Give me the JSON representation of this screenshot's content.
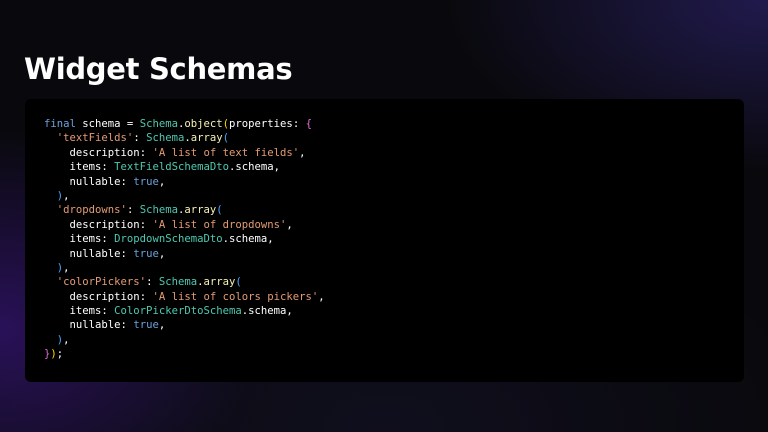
{
  "slide": {
    "title": "Widget Schemas"
  },
  "colors": {
    "background": "#09090d",
    "panel": "#000000",
    "keyword": "#6ba2dc",
    "class_name": "#4ec9b0",
    "method": "#f4f1b4",
    "string": "#e49b74",
    "bracket_level_1": "#ffd700",
    "bracket_level_2": "#da70d6",
    "bracket_level_3": "#4aa8ff"
  },
  "code": {
    "language": "dart",
    "lines": [
      [
        [
          "kw",
          "final"
        ],
        [
          "id",
          " schema "
        ],
        [
          "punc",
          "= "
        ],
        [
          "cls",
          "Schema"
        ],
        [
          "punc",
          "."
        ],
        [
          "fn",
          "object"
        ],
        [
          "p1",
          "("
        ],
        [
          "prop",
          "properties"
        ],
        [
          "punc",
          ": "
        ],
        [
          "p2",
          "{"
        ]
      ],
      [
        [
          "id",
          "  "
        ],
        [
          "str",
          "'textFields'"
        ],
        [
          "punc",
          ": "
        ],
        [
          "cls",
          "Schema"
        ],
        [
          "punc",
          "."
        ],
        [
          "fn",
          "array"
        ],
        [
          "p3",
          "("
        ]
      ],
      [
        [
          "id",
          "    "
        ],
        [
          "prop",
          "description"
        ],
        [
          "punc",
          ": "
        ],
        [
          "str",
          "'A list of text fields'"
        ],
        [
          "punc",
          ","
        ]
      ],
      [
        [
          "id",
          "    "
        ],
        [
          "prop",
          "items"
        ],
        [
          "punc",
          ": "
        ],
        [
          "cls",
          "TextFieldSchemaDto"
        ],
        [
          "punc",
          "."
        ],
        [
          "prop",
          "schema"
        ],
        [
          "punc",
          ","
        ]
      ],
      [
        [
          "id",
          "    "
        ],
        [
          "prop",
          "nullable"
        ],
        [
          "punc",
          ": "
        ],
        [
          "bool",
          "true"
        ],
        [
          "punc",
          ","
        ]
      ],
      [
        [
          "id",
          "  "
        ],
        [
          "p3",
          ")"
        ],
        [
          "punc",
          ","
        ]
      ],
      [
        [
          "id",
          "  "
        ],
        [
          "str",
          "'dropdowns'"
        ],
        [
          "punc",
          ": "
        ],
        [
          "cls",
          "Schema"
        ],
        [
          "punc",
          "."
        ],
        [
          "fn",
          "array"
        ],
        [
          "p3",
          "("
        ]
      ],
      [
        [
          "id",
          "    "
        ],
        [
          "prop",
          "description"
        ],
        [
          "punc",
          ": "
        ],
        [
          "str",
          "'A list of dropdowns'"
        ],
        [
          "punc",
          ","
        ]
      ],
      [
        [
          "id",
          "    "
        ],
        [
          "prop",
          "items"
        ],
        [
          "punc",
          ": "
        ],
        [
          "cls",
          "DropdownSchemaDto"
        ],
        [
          "punc",
          "."
        ],
        [
          "prop",
          "schema"
        ],
        [
          "punc",
          ","
        ]
      ],
      [
        [
          "id",
          "    "
        ],
        [
          "prop",
          "nullable"
        ],
        [
          "punc",
          ": "
        ],
        [
          "bool",
          "true"
        ],
        [
          "punc",
          ","
        ]
      ],
      [
        [
          "id",
          "  "
        ],
        [
          "p3",
          ")"
        ],
        [
          "punc",
          ","
        ]
      ],
      [
        [
          "id",
          "  "
        ],
        [
          "str",
          "'colorPickers'"
        ],
        [
          "punc",
          ": "
        ],
        [
          "cls",
          "Schema"
        ],
        [
          "punc",
          "."
        ],
        [
          "fn",
          "array"
        ],
        [
          "p3",
          "("
        ]
      ],
      [
        [
          "id",
          "    "
        ],
        [
          "prop",
          "description"
        ],
        [
          "punc",
          ": "
        ],
        [
          "str",
          "'A list of colors pickers'"
        ],
        [
          "punc",
          ","
        ]
      ],
      [
        [
          "id",
          "    "
        ],
        [
          "prop",
          "items"
        ],
        [
          "punc",
          ": "
        ],
        [
          "cls",
          "ColorPickerDtoSchema"
        ],
        [
          "punc",
          "."
        ],
        [
          "prop",
          "schema"
        ],
        [
          "punc",
          ","
        ]
      ],
      [
        [
          "id",
          "    "
        ],
        [
          "prop",
          "nullable"
        ],
        [
          "punc",
          ": "
        ],
        [
          "bool",
          "true"
        ],
        [
          "punc",
          ","
        ]
      ],
      [
        [
          "id",
          "  "
        ],
        [
          "p3",
          ")"
        ],
        [
          "punc",
          ","
        ]
      ],
      [
        [
          "p2",
          "}"
        ],
        [
          "p1",
          ")"
        ],
        [
          "punc",
          ";"
        ]
      ]
    ]
  }
}
